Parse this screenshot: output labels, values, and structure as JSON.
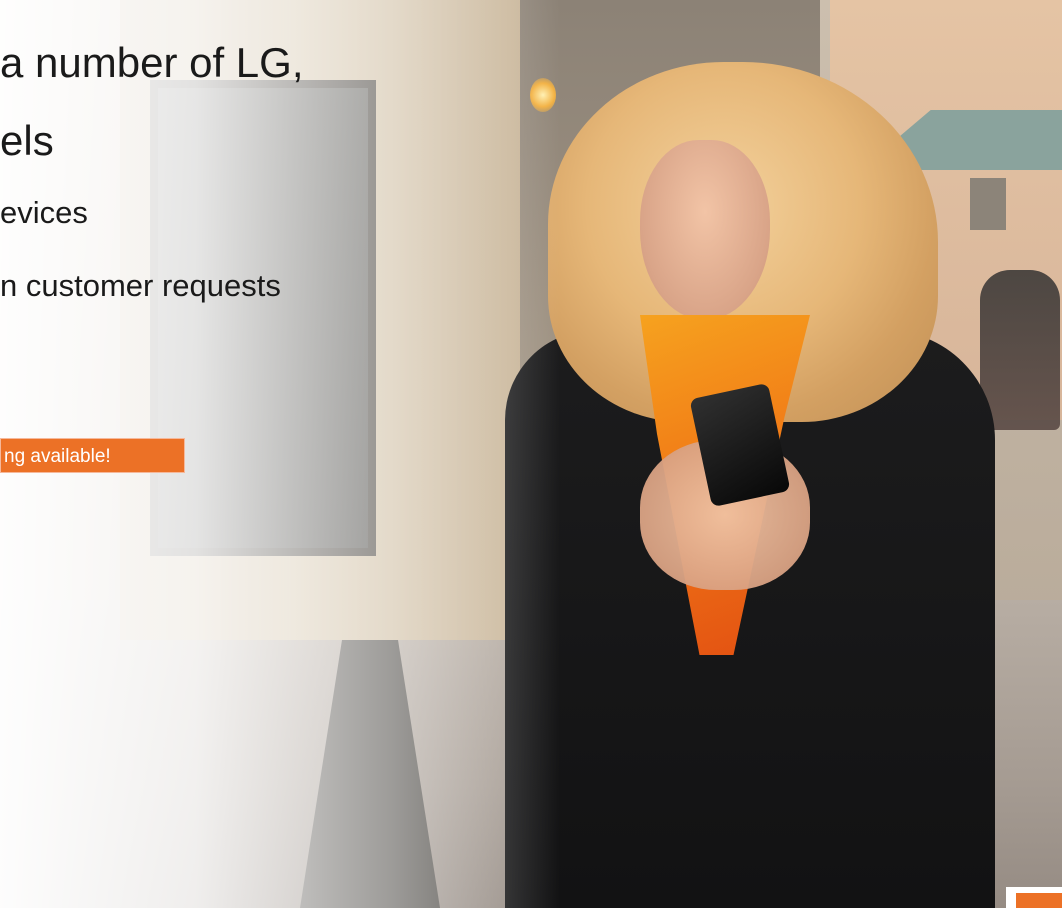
{
  "slide": {
    "heading_lines": [
      "a number of LG,",
      "els"
    ],
    "bullets": [
      "evices",
      "n customer requests"
    ],
    "callout": "ng available!"
  },
  "colors": {
    "accent": "#ec7126",
    "text": "#1a1a1a",
    "callout_text": "#ffffff"
  },
  "photo": {
    "subject": "woman-using-phone-photo"
  }
}
